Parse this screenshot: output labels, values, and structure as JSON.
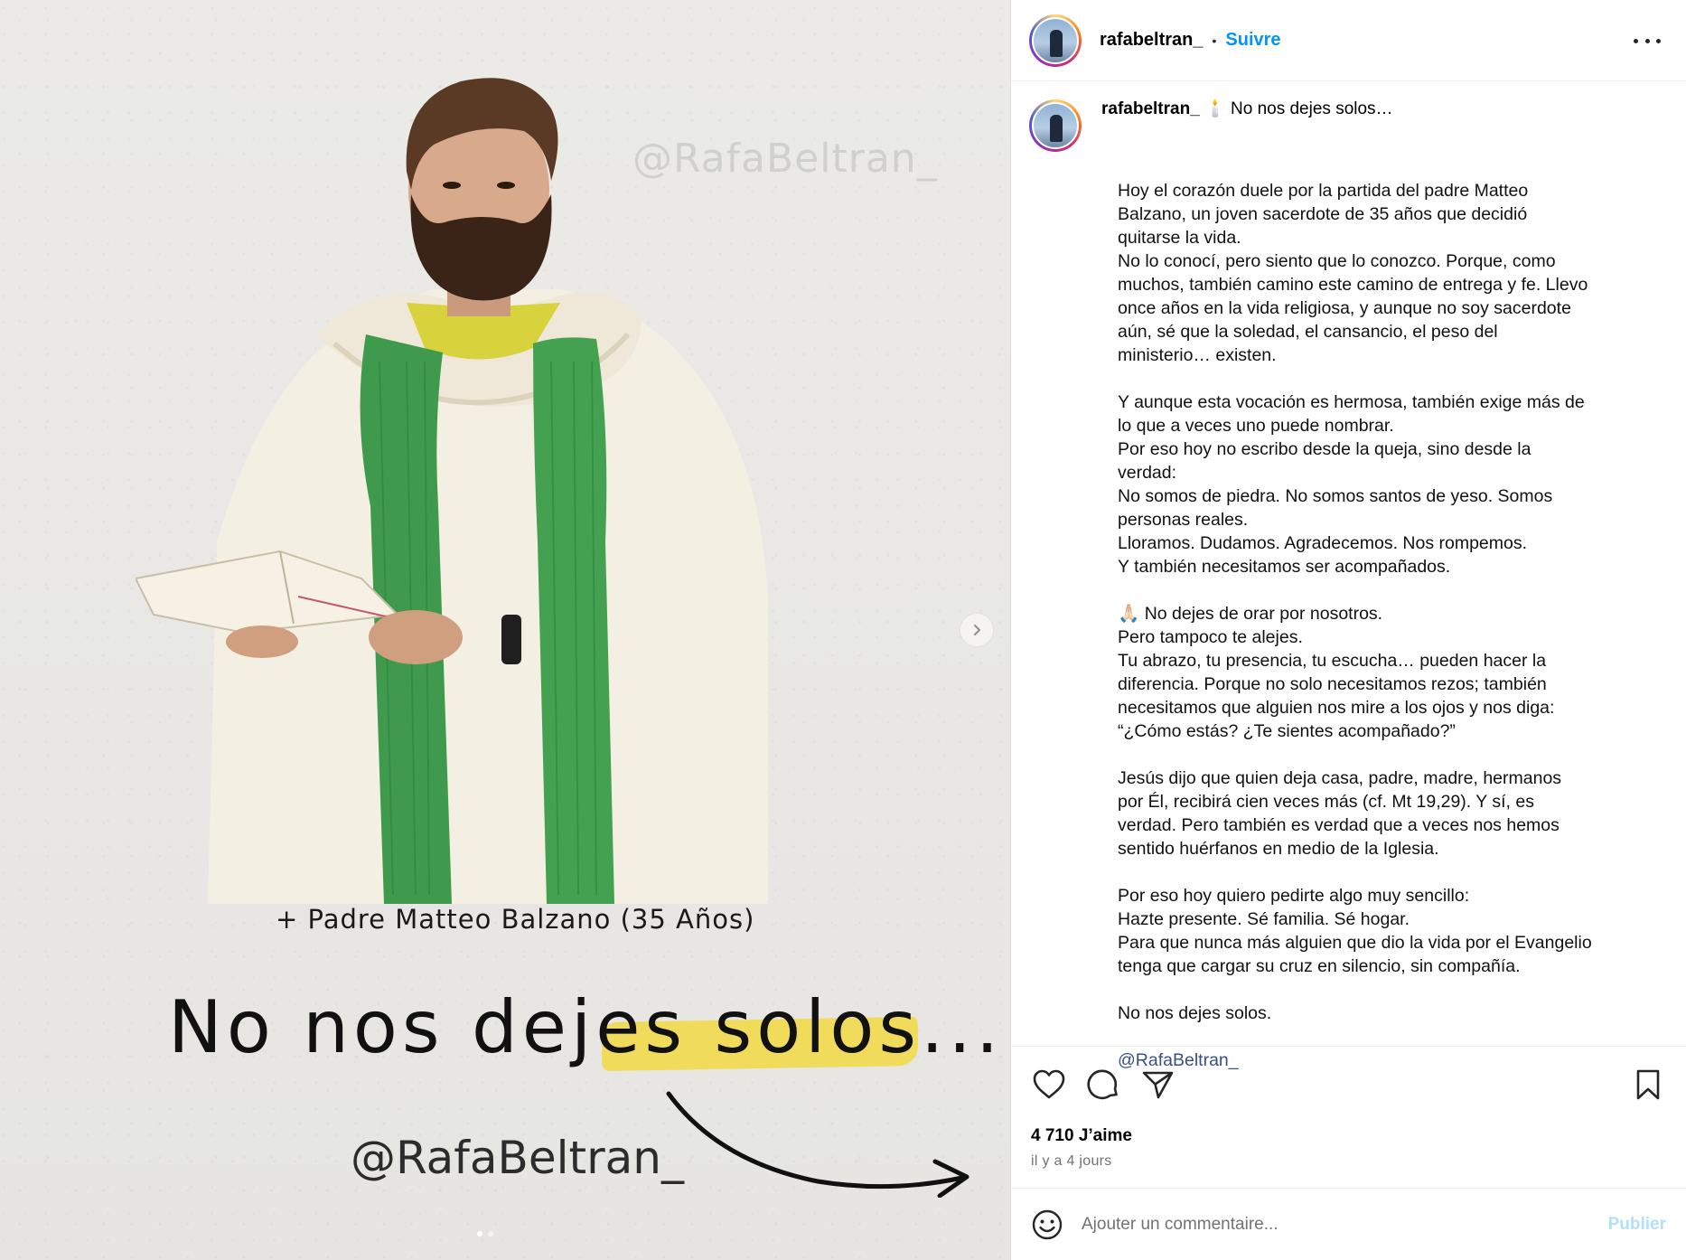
{
  "post_image": {
    "watermark_top": "@RafaBeltran_",
    "caption_line": "+ Padre Matteo Balzano (35 Años)",
    "headline_start": "No nos dejes ",
    "headline_highlight": "solos...",
    "handle_bottom": "@RafaBeltran_"
  },
  "header": {
    "username": "rafabeltran_",
    "separator": "•",
    "follow_label": "Suivre"
  },
  "caption": {
    "username": "rafabeltran_",
    "emoji": "🕯️",
    "title": "No nos dejes solos…",
    "paragraphs": [
      [
        "Hoy el corazón duele por la partida del padre Matteo",
        "Balzano, un joven sacerdote de 35 años que decidió",
        "quitarse la vida.",
        "No lo conocí, pero siento que lo conozco. Porque, como",
        "muchos, también camino este camino de entrega y fe. Llevo",
        "once años en la vida religiosa, y aunque no soy sacerdote",
        "aún, sé que la soledad, el cansancio, el peso del",
        "ministerio… existen."
      ],
      [
        "Y aunque esta vocación es hermosa, también exige más de",
        "lo que a veces uno puede nombrar.",
        "Por eso hoy no escribo desde la queja, sino desde la",
        "verdad:",
        "No somos de piedra. No somos santos de yeso. Somos",
        "personas reales.",
        "Lloramos. Dudamos. Agradecemos. Nos rompemos.",
        "Y también necesitamos ser acompañados."
      ],
      [
        "🙏🏻 No dejes de orar por nosotros.",
        "Pero tampoco te alejes.",
        "Tu abrazo, tu presencia, tu escucha… pueden hacer la",
        "diferencia. Porque no solo necesitamos rezos; también",
        "necesitamos que alguien nos mire a los ojos y nos diga:",
        "“¿Cómo estás? ¿Te sientes acompañado?”"
      ],
      [
        "Jesús dijo que quien deja casa, padre, madre, hermanos",
        "por Él, recibirá cien veces más (cf. Mt 19,29). Y sí, es",
        "verdad. Pero también es verdad que a veces nos hemos",
        "sentido huérfanos en medio de la Iglesia."
      ],
      [
        "Por eso hoy quiero pedirte algo muy sencillo:",
        "Hazte presente. Sé familia. Sé hogar.",
        "Para que nunca más alguien que dio la vida por el Evangelio",
        "tenga que cargar su cruz en silencio, sin compañía."
      ],
      [
        "No nos dejes solos."
      ]
    ],
    "mention": "@RafaBeltran_"
  },
  "actions": {
    "icons": [
      "heart-icon",
      "comment-icon",
      "share-icon",
      "bookmark-icon"
    ],
    "likes": "4 710 J’aime",
    "time": "il y a 4 jours"
  },
  "comment": {
    "placeholder": "Ajouter un commentaire...",
    "publish_label": "Publier"
  },
  "colors": {
    "follow": "#0095f6",
    "publish_disabled": "#b2dffc",
    "mention": "#385185",
    "highlight": "#f1da4f",
    "stole_green": "#3f9a4d"
  }
}
